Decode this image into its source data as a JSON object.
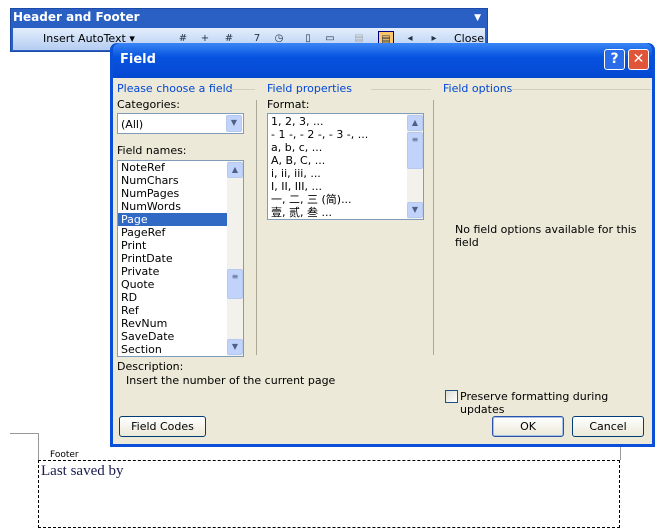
{
  "toolbar": {
    "title": "Header and Footer",
    "insert_autotext": "Insert AutoText ▾",
    "close": "Close"
  },
  "dialog": {
    "title": "Field",
    "help": "?",
    "close": "✕",
    "choose_group": "Please choose a field",
    "categories_label": "Categories:",
    "categories_value": "(All)",
    "field_names_label": "Field names:",
    "field_names": [
      "NoteRef",
      "NumChars",
      "NumPages",
      "NumWords",
      "Page",
      "PageRef",
      "Print",
      "PrintDate",
      "Private",
      "Quote",
      "RD",
      "Ref",
      "RevNum",
      "SaveDate",
      "Section"
    ],
    "selected_field": "Page",
    "properties_group": "Field properties",
    "format_label": "Format:",
    "formats": [
      "1, 2, 3, ...",
      "- 1 -, - 2 -, - 3 -, ...",
      "a, b, c, ...",
      "A, B, C, ...",
      "i, ii, iii, ...",
      "I, II, III, ...",
      "一, 二, 三 (简)...",
      "壹, 贰, 叁 ..."
    ],
    "options_group": "Field options",
    "no_options": "No field options available for this field",
    "description_label": "Description:",
    "description": "Insert the number of the current page",
    "preserve_label": "Preserve formatting during updates",
    "preserve_checked": false,
    "field_codes": "Field Codes",
    "ok": "OK",
    "cancel": "Cancel"
  },
  "document": {
    "footer_label": "Footer",
    "footer_text": "Last saved by"
  }
}
